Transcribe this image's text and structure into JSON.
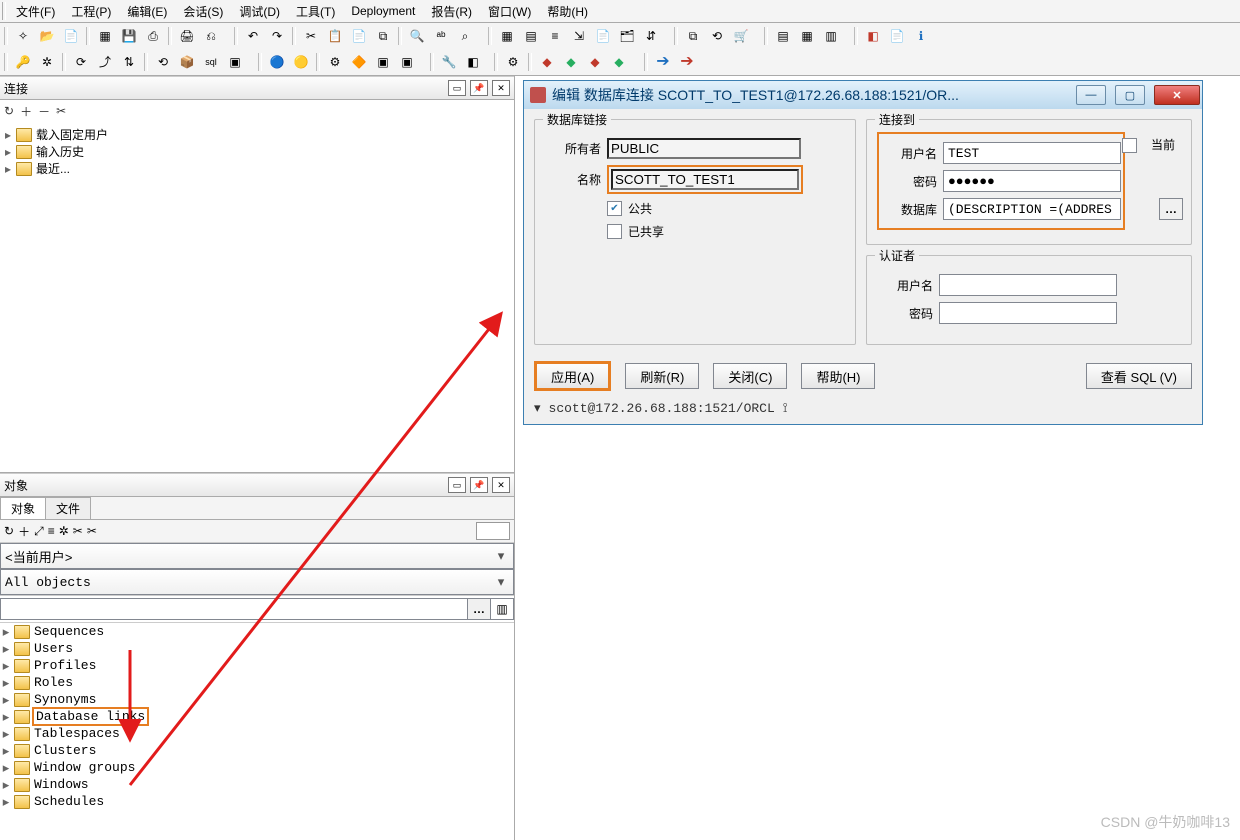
{
  "menu": [
    "文件(F)",
    "工程(P)",
    "编辑(E)",
    "会话(S)",
    "调试(D)",
    "工具(T)",
    "Deployment",
    "报告(R)",
    "窗口(W)",
    "帮助(H)"
  ],
  "panels": {
    "connect_title": "连接",
    "objects_title": "对象"
  },
  "conn_tree": {
    "items": [
      "载入固定用户",
      "输入历史",
      "最近..."
    ]
  },
  "obj_tabs": {
    "a": "对象",
    "b": "文件"
  },
  "obj_dropdown1": "<当前用户>",
  "obj_dropdown2": "All objects",
  "obj_filter": "",
  "obj_tree": [
    "Sequences",
    "Users",
    "Profiles",
    "Roles",
    "Synonyms",
    "Database links",
    "Tablespaces",
    "Clusters",
    "Window groups",
    "Windows",
    "Schedules"
  ],
  "obj_highlight": "Database links",
  "dialog": {
    "title": "编辑 数据库连接 SCOTT_TO_TEST1@172.26.68.188:1521/OR...",
    "grp_link": "数据库链接",
    "owner_label": "所有者",
    "owner_value": "PUBLIC",
    "name_label": "名称",
    "name_value": "SCOTT_TO_TEST1",
    "public_label": "公共",
    "shared_label": "已共享",
    "grp_conn": "连接到",
    "user_label": "用户名",
    "user_value": "TEST",
    "current_label": "当前",
    "pwd_label": "密码",
    "pwd_value": "●●●●●●",
    "db_label": "数据库",
    "db_value": "(DESCRIPTION =(ADDRES",
    "grp_auth": "认证者",
    "auth_user_label": "用户名",
    "auth_pwd_label": "密码",
    "btn_apply": "应用(A)",
    "btn_refresh": "刷新(R)",
    "btn_close": "关闭(C)",
    "btn_help": "帮助(H)",
    "btn_sql": "查看 SQL (V)",
    "status": "scott@172.26.68.188:1521/ORCL"
  },
  "watermark": "CSDN @牛奶咖啡13",
  "icons": {
    "toolbar1": [
      "✧",
      "📂",
      "📄",
      "▦",
      "💾",
      "⎙",
      "🖨",
      "⎌"
    ],
    "toolbar1b": [
      "↶",
      "↷",
      "✂",
      "📋",
      "📄",
      "⧉",
      "🔍",
      "ᵃᵇ",
      "⌕"
    ],
    "toolbar1c": [
      "▦",
      "▤",
      "≡",
      "⇲",
      "📄",
      "🗂",
      "⇵"
    ],
    "toolbar1d": [
      "⧉",
      "⟲",
      "🛒"
    ],
    "toolbar1e": [
      "▤",
      "▦",
      "▥"
    ],
    "toolbar1f": [
      "◧",
      "📄",
      "ℹ"
    ],
    "toolbar2": [
      "🔑",
      "✲",
      "⟳",
      "⤴",
      "⇅",
      "⟲",
      "📦",
      "sql",
      "▣"
    ],
    "toolbar2b": [
      "🔵",
      "🟡",
      "⚙",
      "🔶",
      "▣",
      "▣"
    ],
    "toolbar2c": [
      "🔧",
      "◧"
    ],
    "toolbar2d": [
      "⚙",
      "◆",
      "◆",
      "◆",
      "◆"
    ],
    "toolbar2e": [
      "➔",
      "➔"
    ]
  }
}
